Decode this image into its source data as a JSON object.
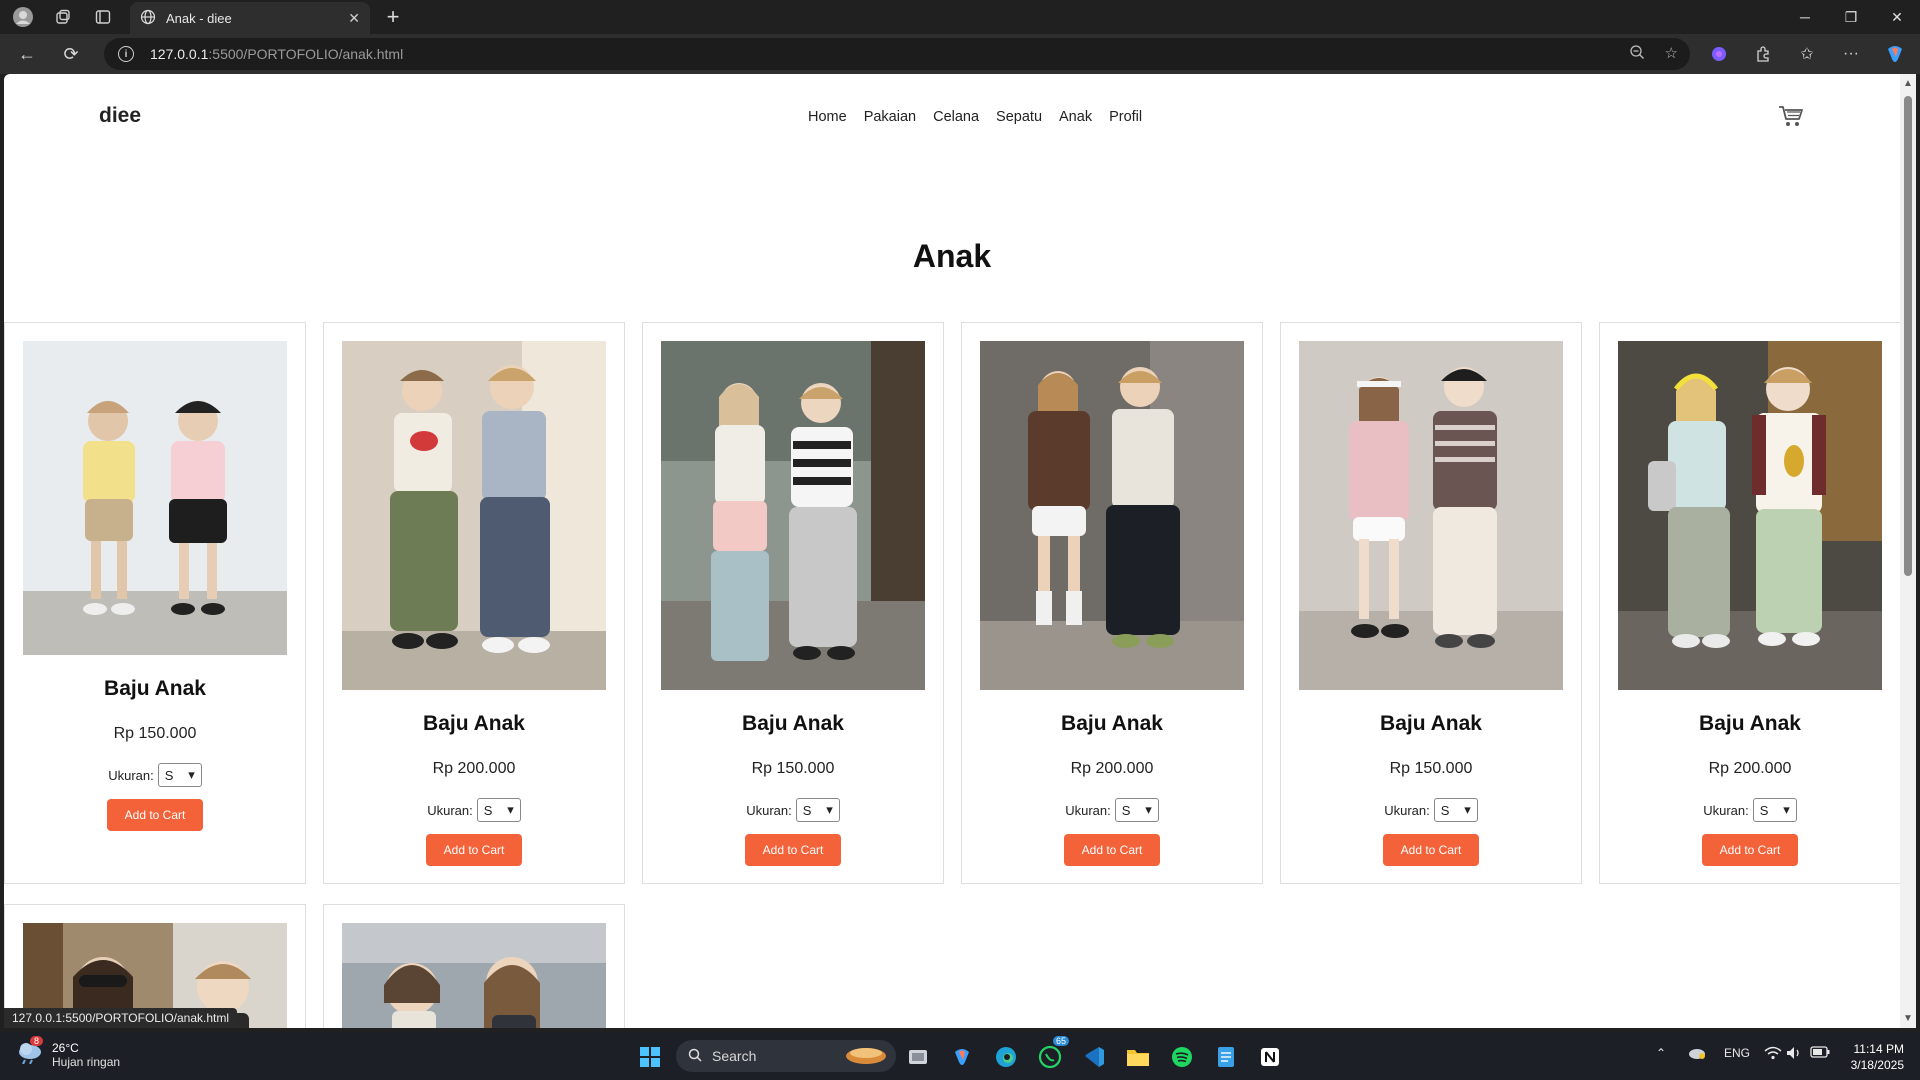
{
  "browser": {
    "tab_title": "Anak - diee",
    "url_host": "127.0.0.1",
    "url_rest": ":5500/PORTOFOLIO/anak.html",
    "status_url": "127.0.0.1:5500/PORTOFOLIO/anak.html"
  },
  "site": {
    "logo": "diee",
    "nav": [
      "Home",
      "Pakaian",
      "Celana",
      "Sepatu",
      "Anak",
      "Profil"
    ],
    "page_title": "Anak"
  },
  "products": [
    {
      "name": "Baju Anak",
      "price": "Rp 150.000",
      "size_label": "Ukuran:",
      "size": "S",
      "button": "Add to Cart"
    },
    {
      "name": "Baju Anak",
      "price": "Rp 200.000",
      "size_label": "Ukuran:",
      "size": "S",
      "button": "Add to Cart"
    },
    {
      "name": "Baju Anak",
      "price": "Rp 150.000",
      "size_label": "Ukuran:",
      "size": "S",
      "button": "Add to Cart"
    },
    {
      "name": "Baju Anak",
      "price": "Rp 200.000",
      "size_label": "Ukuran:",
      "size": "S",
      "button": "Add to Cart"
    },
    {
      "name": "Baju Anak",
      "price": "Rp 150.000",
      "size_label": "Ukuran:",
      "size": "S",
      "button": "Add to Cart"
    },
    {
      "name": "Baju Anak",
      "price": "Rp 200.000",
      "size_label": "Ukuran:",
      "size": "S",
      "button": "Add to Cart"
    }
  ],
  "taskbar": {
    "temperature": "26°C",
    "condition": "Hujan ringan",
    "weather_badge": "8",
    "search_label": "Search",
    "whatsapp_badge": "65",
    "language": "ENG",
    "time": "11:14 PM",
    "date": "3/18/2025"
  },
  "colors": {
    "accent_button": "#f4623a",
    "page_bg": "#ffffff",
    "chrome_bg": "#202020"
  }
}
